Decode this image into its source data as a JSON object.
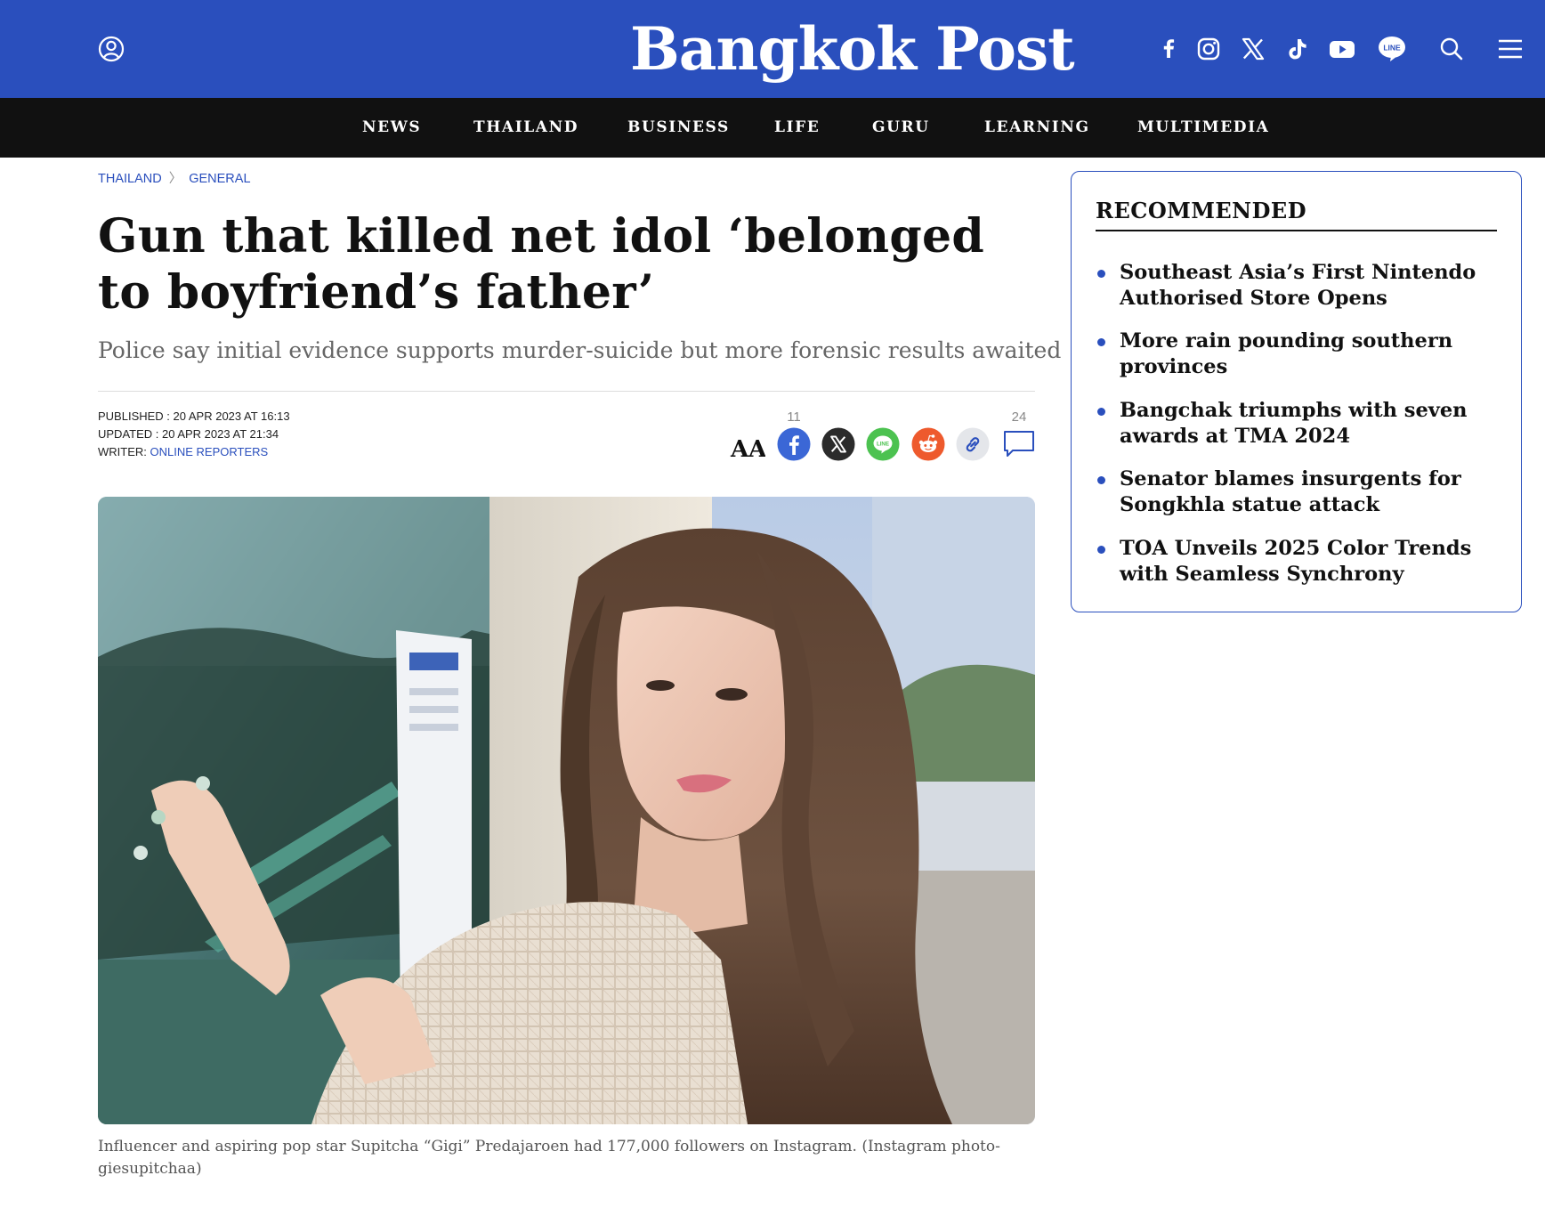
{
  "header": {
    "logo_text": "Bangkok Post",
    "brand_color": "#2a4fbd",
    "icons": [
      "user-icon",
      "facebook-icon",
      "instagram-icon",
      "x-icon",
      "tiktok-icon",
      "youtube-icon",
      "line-icon",
      "search-icon",
      "menu-icon"
    ]
  },
  "nav": {
    "items": [
      "NEWS",
      "THAILAND",
      "BUSINESS",
      "LIFE",
      "GURU",
      "LEARNING",
      "MULTIMEDIA"
    ]
  },
  "breadcrumb": {
    "section": "THAILAND",
    "separator": "〉",
    "subsection": "GENERAL"
  },
  "article": {
    "headline": "Gun that killed net idol ‘belonged to boyfriend’s father’",
    "subhead": "Police say initial evidence supports murder-suicide but more forensic results awaited",
    "published": "PUBLISHED : 20 APR 2023 AT 16:13",
    "updated": "UPDATED : 20 APR 2023 AT 21:34",
    "writer_label": "WRITER: ",
    "writer": "ONLINE REPORTERS",
    "share": {
      "font_size_icon": "AA",
      "facebook_count": "11",
      "comments_count": "24",
      "icons": [
        "font-size-icon",
        "facebook-icon",
        "x-icon",
        "line-icon",
        "reddit-icon",
        "copy-link-icon",
        "comment-icon"
      ]
    },
    "image_caption": "Influencer and aspiring pop star Supitcha “Gigi” Predajaroen had 177,000 followers on Instagram. (Instagram photo-giesupitchaa)"
  },
  "recommended": {
    "title": "RECOMMENDED",
    "items": [
      "Southeast Asia’s First Nintendo Authorised Store Opens",
      "More rain pounding southern provinces",
      "Bangchak triumphs with seven awards at TMA 2024",
      "Senator blames insurgents for Songkhla statue attack",
      "TOA Unveils 2025 Color Trends with Seamless Synchrony"
    ]
  }
}
